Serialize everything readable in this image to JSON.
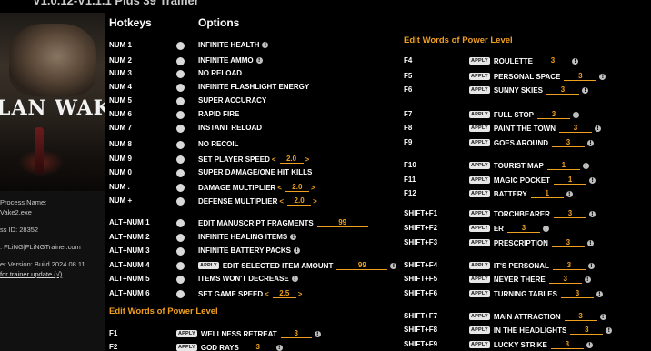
{
  "window": {
    "title": "V1.0.12-V1.1.1 Plus 39 Trainer"
  },
  "sidebar": {
    "game_logo": "LAN WAKE II",
    "process_label": "Process Name:",
    "process_value": "Vake2.exe",
    "pid": "ss ID: 28352",
    "author": ": FLiNG|FLiNGTrainer.com",
    "version": "er Version: Build.2024.08.11",
    "update_link": "for trainer update (√)"
  },
  "headers": {
    "hotkeys": "Hotkeys",
    "options": "Options"
  },
  "left_options": [
    {
      "key": "NUM 1",
      "label": "INFINITE HEALTH",
      "info": true
    },
    {
      "key": "NUM 2",
      "label": "INFINITE AMMO",
      "info": true
    },
    {
      "key": "NUM 3",
      "label": "NO RELOAD"
    },
    {
      "key": "NUM 4",
      "label": "INFINITE FLASHLIGHT ENERGY"
    },
    {
      "key": "NUM 5",
      "label": "SUPER ACCURACY"
    },
    {
      "key": "NUM 6",
      "label": "RAPID FIRE"
    },
    {
      "key": "NUM 7",
      "label": "INSTANT RELOAD"
    },
    {
      "key": "NUM 8",
      "label": "NO RECOIL"
    },
    {
      "key": "NUM 9",
      "label": "SET PLAYER SPEED",
      "value": "2.0"
    },
    {
      "key": "NUM 0",
      "label": "SUPER DAMAGE/ONE HIT KILLS"
    },
    {
      "key": "NUM .",
      "label": "DAMAGE MULTIPLIER",
      "value": "2.0"
    },
    {
      "key": "NUM +",
      "label": "DEFENSE MULTIPLIER",
      "value": "2.0"
    },
    {
      "key": "ALT+NUM 1",
      "label": "EDIT MANUSCRIPT FRAGMENTS",
      "edit": "99"
    },
    {
      "key": "ALT+NUM 2",
      "label": "INFINITE HEALING ITEMS",
      "info": true
    },
    {
      "key": "ALT+NUM 3",
      "label": "INFINITE BATTERY PACKS",
      "info": true
    },
    {
      "key": "ALT+NUM 4",
      "label": "EDIT SELECTED ITEM AMOUNT",
      "edit": "99",
      "apply": "APPLY",
      "info": true
    },
    {
      "key": "ALT+NUM 5",
      "label": "ITEMS WON'T DECREASE",
      "info": true
    },
    {
      "key": "ALT+NUM 6",
      "label": "SET GAME SPEED",
      "value": "2.5"
    }
  ],
  "left_words_section": "Edit Words of Power Level",
  "left_words": [
    {
      "key": "F1",
      "label": "WELLNESS RETREAT",
      "value": "3",
      "apply": "APPLY"
    },
    {
      "key": "F2",
      "label": "GOD RAYS",
      "value": "3",
      "apply": "APPLY"
    }
  ],
  "right_section": "Edit Words of Power Level",
  "right_words": [
    {
      "key": "F4",
      "label": "ROULETTE",
      "value": "3"
    },
    {
      "key": "F5",
      "label": "PERSONAL SPACE",
      "value": "3"
    },
    {
      "key": "F6",
      "label": "SUNNY SKIES",
      "value": "3"
    },
    {
      "key": "F7",
      "label": "FULL STOP",
      "value": "3"
    },
    {
      "key": "F8",
      "label": "PAINT THE TOWN",
      "value": "3"
    },
    {
      "key": "F9",
      "label": "GOES AROUND",
      "value": "3"
    },
    {
      "key": "F10",
      "label": "TOURIST MAP",
      "value": "1"
    },
    {
      "key": "F11",
      "label": "MAGIC POCKET",
      "value": "1"
    },
    {
      "key": "F12",
      "label": "BATTERY",
      "value": "1"
    },
    {
      "key": "SHIFT+F1",
      "label": "TORCHBEARER",
      "value": "3"
    },
    {
      "key": "SHIFT+F2",
      "label": "ER",
      "value": "3"
    },
    {
      "key": "SHIFT+F3",
      "label": "PRESCRIPTION",
      "value": "3"
    },
    {
      "key": "SHIFT+F4",
      "label": "IT'S PERSONAL",
      "value": "3"
    },
    {
      "key": "SHIFT+F5",
      "label": "NEVER THERE",
      "value": "3"
    },
    {
      "key": "SHIFT+F6",
      "label": "TURNING TABLES",
      "value": "3"
    },
    {
      "key": "SHIFT+F7",
      "label": "MAIN ATTRACTION",
      "value": "3"
    },
    {
      "key": "SHIFT+F8",
      "label": "IN THE HEADLIGHTS",
      "value": "3"
    },
    {
      "key": "SHIFT+F9",
      "label": "LUCKY STRIKE",
      "value": "3"
    }
  ],
  "apply_label": "APPLY",
  "colors": {
    "accent": "#f0a020",
    "background": "#000000",
    "toggle": "#d9d9d9"
  }
}
